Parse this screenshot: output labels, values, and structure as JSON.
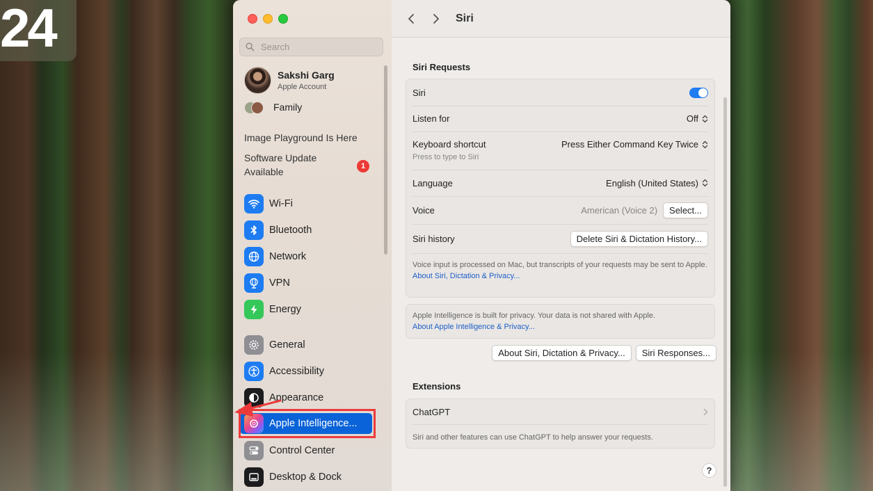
{
  "desktop": {
    "clock_text": "24"
  },
  "sidebar": {
    "search_placeholder": "Search",
    "account": {
      "name": "Sakshi Garg",
      "subtitle": "Apple Account"
    },
    "family_label": "Family",
    "notices": [
      "Image Playground Is Here",
      "Software Update",
      "Available"
    ],
    "update_badge": "1",
    "items": [
      {
        "label": "Wi-Fi",
        "icon": "wifi-icon",
        "color": "#1e7cf2"
      },
      {
        "label": "Bluetooth",
        "icon": "bluetooth-icon",
        "color": "#1e7cf2"
      },
      {
        "label": "Network",
        "icon": "globe-icon",
        "color": "#1e7cf2"
      },
      {
        "label": "VPN",
        "icon": "vpn-globe-icon",
        "color": "#1e7cf2"
      },
      {
        "label": "Energy",
        "icon": "bolt-icon",
        "color": "#34c759"
      },
      {
        "label": "General",
        "icon": "gear-icon",
        "color": "#8e8e93"
      },
      {
        "label": "Accessibility",
        "icon": "accessibility-icon",
        "color": "#1e7cf2"
      },
      {
        "label": "Appearance",
        "icon": "appearance-icon",
        "color": "#1c1c1e"
      },
      {
        "label": "Apple Intelligence...",
        "icon": "apple-intelligence-icon",
        "color": "#0a63d8"
      },
      {
        "label": "Control Center",
        "icon": "control-center-icon",
        "color": "#8e8e93"
      },
      {
        "label": "Desktop & Dock",
        "icon": "dock-icon",
        "color": "#1c1c1e"
      }
    ]
  },
  "main": {
    "title": "Siri",
    "siri_requests": {
      "heading": "Siri Requests",
      "siri_label": "Siri",
      "siri_enabled": true,
      "listen_for_label": "Listen for",
      "listen_for_value": "Off",
      "shortcut_label": "Keyboard shortcut",
      "shortcut_sub": "Press to type to Siri",
      "shortcut_value": "Press Either Command Key Twice",
      "language_label": "Language",
      "language_value": "English (United States)",
      "voice_label": "Voice",
      "voice_value": "American (Voice 2)",
      "voice_button": "Select...",
      "history_label": "Siri history",
      "history_button": "Delete Siri & Dictation History...",
      "privacy_note": "Voice input is processed on Mac, but transcripts of your requests may be sent to Apple.",
      "privacy_link": "About Siri, Dictation & Privacy..."
    },
    "ai_note": {
      "text": "Apple Intelligence is built for privacy. Your data is not shared with Apple.",
      "link": "About Apple Intelligence & Privacy..."
    },
    "buttons": {
      "about_privacy": "About Siri, Dictation & Privacy...",
      "siri_responses": "Siri Responses..."
    },
    "extensions": {
      "heading": "Extensions",
      "chatgpt_label": "ChatGPT",
      "chatgpt_note": "Siri and other features can use ChatGPT to help answer your requests."
    },
    "help": "?"
  }
}
